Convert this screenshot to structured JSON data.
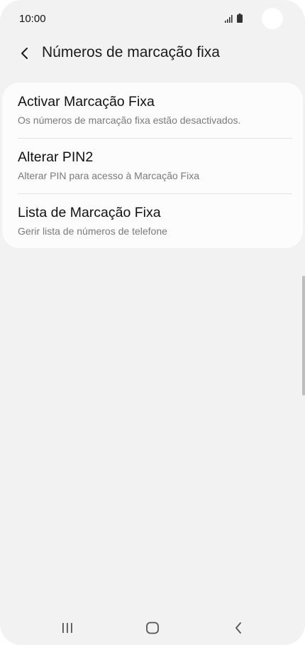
{
  "status_bar": {
    "time": "10:00"
  },
  "header": {
    "title": "Números de marcação fixa",
    "back_icon": "chevron-left-icon"
  },
  "settings": [
    {
      "title": "Activar Marcação Fixa",
      "subtitle": "Os números de marcação fixa estão desactivados."
    },
    {
      "title": "Alterar PIN2",
      "subtitle": "Alterar PIN para acesso à Marcação Fixa"
    },
    {
      "title": "Lista de Marcação Fixa",
      "subtitle": "Gerir lista de números de telefone"
    }
  ],
  "nav_bar": {
    "recents_icon": "recent-apps-icon",
    "home_icon": "home-icon",
    "back_icon": "back-icon"
  },
  "colors": {
    "background": "#f2f2f2",
    "card": "#fcfcfc",
    "text_primary": "#111111",
    "text_secondary": "#7a7a7a"
  }
}
